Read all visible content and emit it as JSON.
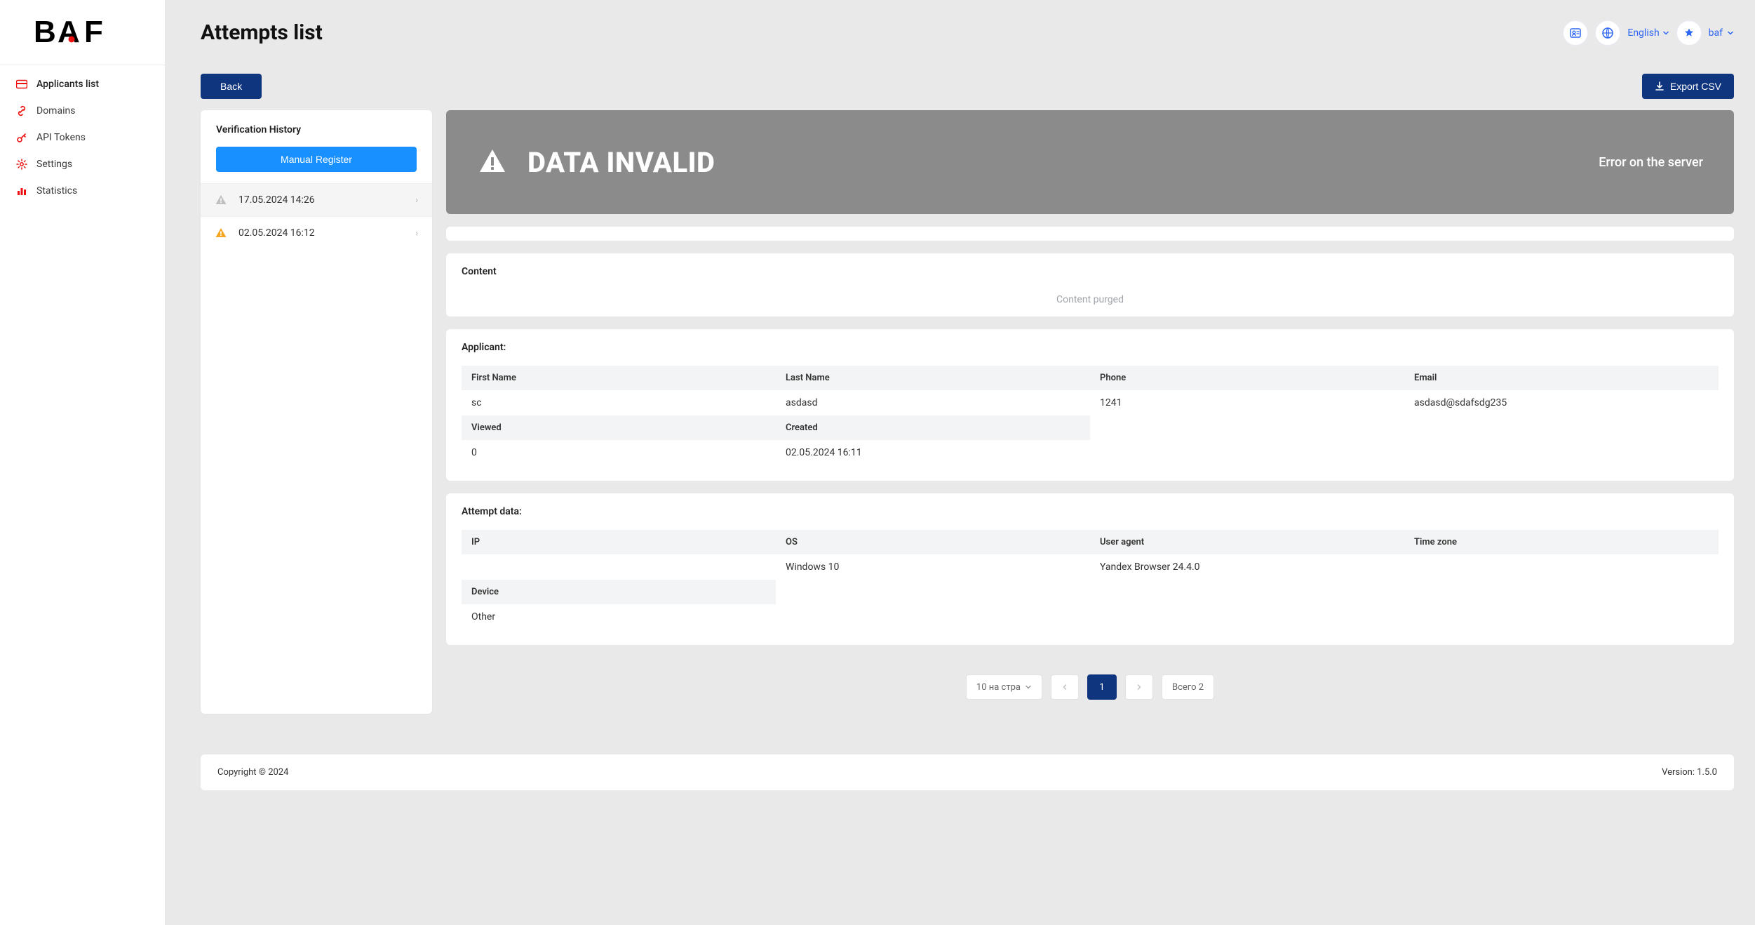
{
  "brand": "BAF",
  "sidebar": {
    "items": [
      {
        "label": "Applicants list"
      },
      {
        "label": "Domains"
      },
      {
        "label": "API Tokens"
      },
      {
        "label": "Settings"
      },
      {
        "label": "Statistics"
      }
    ]
  },
  "header": {
    "title": "Attempts list",
    "language": "English",
    "user": "baf"
  },
  "actions": {
    "back": "Back",
    "export": "Export CSV"
  },
  "history": {
    "title": "Verification History",
    "manual_register": "Manual Register",
    "items": [
      {
        "ts": "17.05.2024 14:26",
        "status": "invalid"
      },
      {
        "ts": "02.05.2024 16:12",
        "status": "warning"
      }
    ]
  },
  "banner": {
    "title": "DATA INVALID",
    "subtitle": "Error on the server"
  },
  "content": {
    "title": "Content",
    "purged": "Content purged"
  },
  "applicant": {
    "title": "Applicant:",
    "labels": {
      "first_name": "First Name",
      "last_name": "Last Name",
      "phone": "Phone",
      "email": "Email",
      "viewed": "Viewed",
      "created": "Created"
    },
    "values": {
      "first_name": "sc",
      "last_name": "asdasd",
      "phone": "1241",
      "email": "asdasd@sdafsdg235",
      "viewed": "0",
      "created": "02.05.2024   16:11"
    }
  },
  "attempt": {
    "title": "Attempt data:",
    "labels": {
      "ip": "IP",
      "os": "OS",
      "user_agent": "User agent",
      "time_zone": "Time zone",
      "device": "Device"
    },
    "values": {
      "ip": "",
      "os": "Windows 10",
      "user_agent": "Yandex Browser 24.4.0",
      "time_zone": "",
      "device": "Other"
    }
  },
  "pager": {
    "size_label": "10 на стра",
    "page": "1",
    "total_label": "Всего 2"
  },
  "footer": {
    "copyright": "Copyright © 2024",
    "version": "Version: 1.5.0"
  }
}
